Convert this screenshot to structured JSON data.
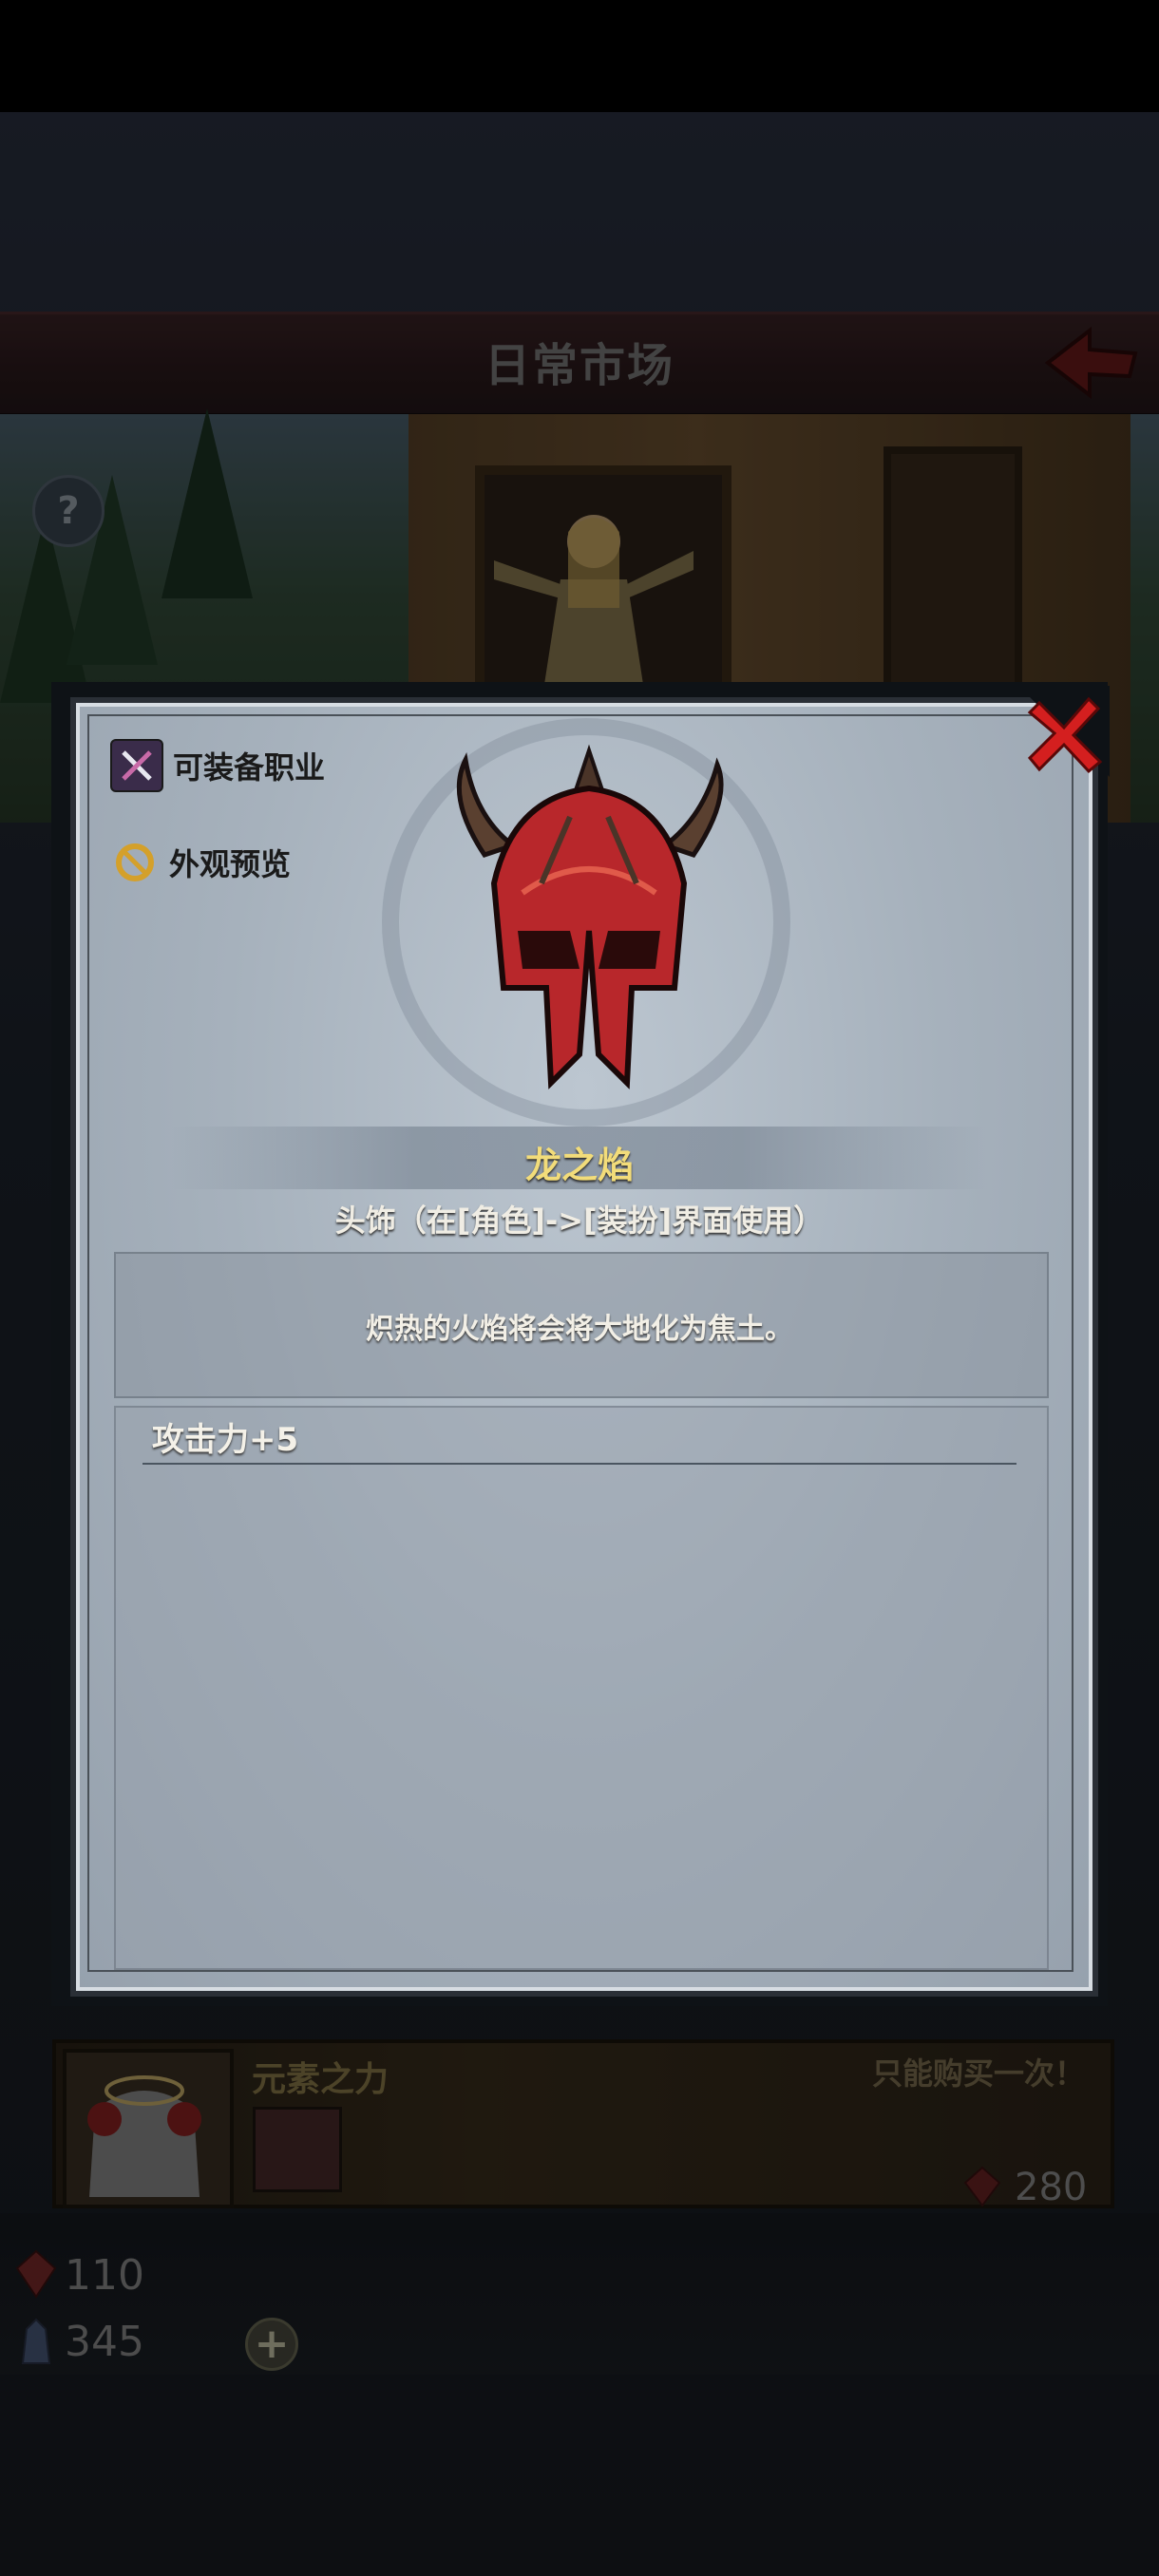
{
  "header": {
    "title": "日常市场"
  },
  "modal": {
    "side_buttons": [
      {
        "label": "可装备职业",
        "icon": "crossed-weapons-icon"
      },
      {
        "label": "外观预览",
        "icon": "preview-swirl-icon"
      }
    ],
    "item": {
      "name": "龙之焰",
      "type": "头饰（在[角色]->[装扮]界面使用）",
      "description": "炽热的火焰将会将大地化为焦土。",
      "stats": [
        "攻击力+5"
      ]
    }
  },
  "shop_list": {
    "item": {
      "title": "元素之力",
      "limit_note": "只能购买一次！",
      "price": "280"
    }
  },
  "currency": {
    "red_gem": "110",
    "blue_crystal": "345"
  },
  "colors": {
    "item_name": "#f2dc7a",
    "close_red": "#d41f1f",
    "header_bg": "#2b1a1c"
  }
}
